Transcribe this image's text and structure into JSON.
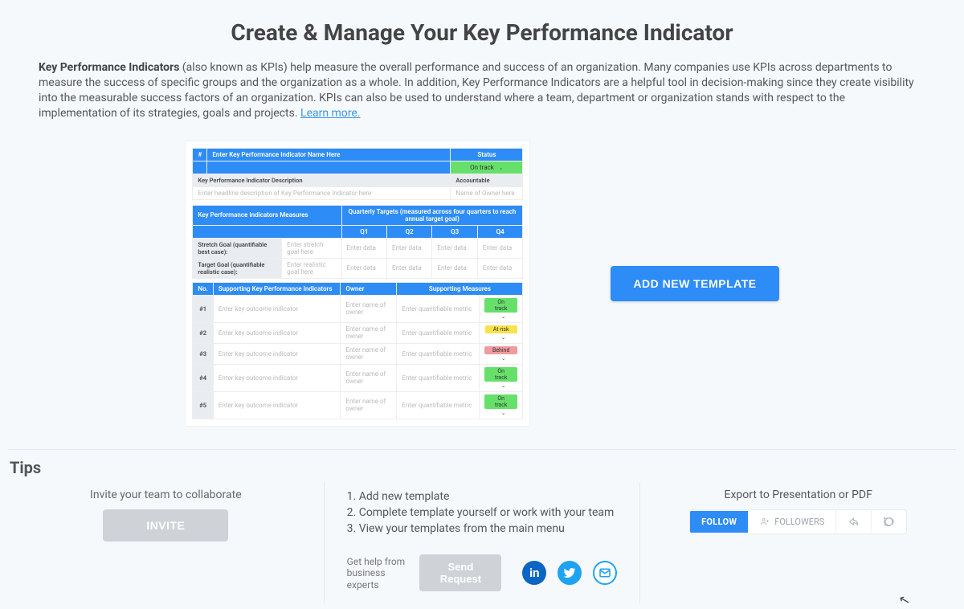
{
  "page": {
    "title": "Create & Manage Your Key Performance Indicator",
    "intro_bold": "Key Performance Indicators",
    "intro_rest": " (also known as KPIs) help measure the overall performance and success of an organization. Many companies use KPIs across departments to measure the success of specific groups and the organization as a whole. In addition, Key Performance Indicators are a helpful tool in decision-making since they create visibility into the measurable success factors of an organization. KPIs can also be used to understand where a team, department or organization stands with respect to the implementation of its strategies, goals and projects. ",
    "learn_more": "Learn more."
  },
  "cta": {
    "add_template": "ADD NEW TEMPLATE"
  },
  "preview": {
    "name_header_hash": "#",
    "name_header_label": "Enter Key Performance Indicator Name Here",
    "status_header": "Status",
    "status_value": "On track",
    "desc_header": "Key Performance Indicator Description",
    "accountable_header": "Accountable",
    "desc_placeholder": "Enter headline description of Key Performance Indicator here",
    "acc_placeholder": "Name of Owner here",
    "measures_header": "Key Performance Indicators Measures",
    "targets_header": "Quarterly Targets (measured across four quarters to reach annual target goal)",
    "q": [
      "Q1",
      "Q2",
      "Q3",
      "Q4"
    ],
    "stretch_label": "Stretch Goal (quantifiable best case):",
    "target_label": "Target Goal (quantifiable realistic case):",
    "goal_placeholder1": "Enter stretch goal here",
    "goal_placeholder2": "Enter realistic goal here",
    "cell_placeholder": "Enter data",
    "support_headers": {
      "no": "No.",
      "kpi": "Supporting Key Performance Indicators",
      "owner": "Owner",
      "measures": "Supporting Measures"
    },
    "owner_placeholder": "Enter name of owner",
    "metric_placeholder": "Enter quantifiable metric",
    "kpi_placeholder": "Enter key outcome indicator",
    "rows": [
      {
        "no": "#1",
        "status": "On track",
        "cls": "s-on"
      },
      {
        "no": "#2",
        "status": "At risk",
        "cls": "s-risk"
      },
      {
        "no": "#3",
        "status": "Behind",
        "cls": "s-behind"
      },
      {
        "no": "#4",
        "status": "On track",
        "cls": "s-on"
      },
      {
        "no": "#5",
        "status": "On track",
        "cls": "s-on"
      }
    ]
  },
  "tips": {
    "heading": "Tips",
    "invite_text": "Invite your team to collaborate",
    "invite_btn": "INVITE",
    "steps": [
      "1. Add new template",
      "2. Complete template yourself or work with your team",
      "3. View your templates from the main menu"
    ],
    "help_label": "Get help from business experts",
    "help_btn": "Send Request",
    "export_label": "Export to Presentation or PDF",
    "follow": "FOLLOW",
    "followers": "FOLLOWERS"
  }
}
